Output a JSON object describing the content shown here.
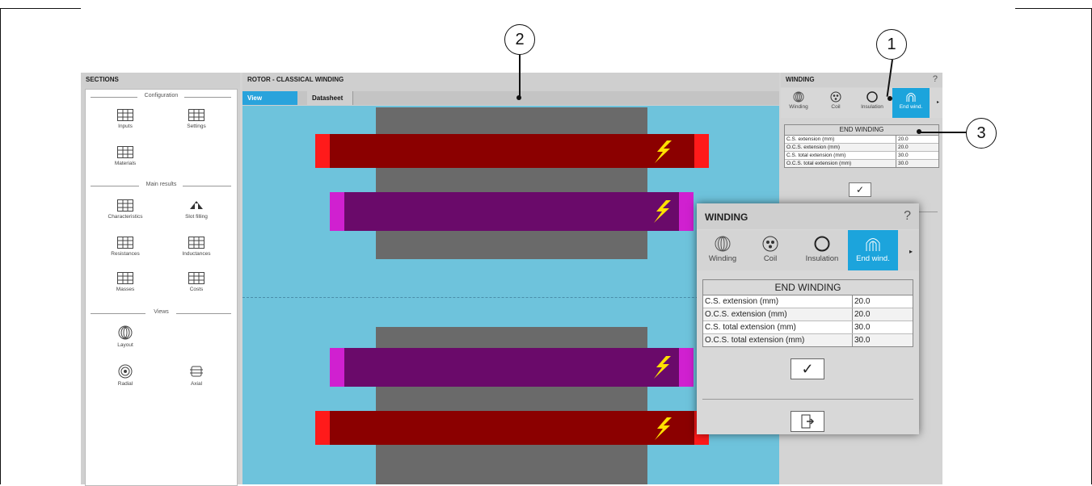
{
  "sections": {
    "header": "SECTIONS",
    "groups": [
      {
        "title": "Configuration",
        "items": [
          "Inputs",
          "Settings",
          "Materials"
        ]
      },
      {
        "title": "Main results",
        "items": [
          "Characteristics",
          "Slot filling",
          "Resistances",
          "Inductances",
          "Masses",
          "Costs"
        ]
      },
      {
        "title": "Views",
        "items": [
          "Layout",
          "Radial",
          "Axial"
        ]
      }
    ]
  },
  "center": {
    "header": "ROTOR - CLASSICAL WINDING",
    "tabs": [
      "View",
      "Datasheet"
    ]
  },
  "winding": {
    "header": "WINDING",
    "help": "?",
    "tabs": [
      "Winding",
      "Coil",
      "Insulation",
      "End wind."
    ],
    "more": "▸",
    "table": {
      "title": "END WINDING",
      "rows": [
        {
          "label": "C.S. extension (mm)",
          "value": "20.0"
        },
        {
          "label": "O.C.S. extension (mm)",
          "value": "20.0"
        },
        {
          "label": "C.S. total extension (mm)",
          "value": "30.0"
        },
        {
          "label": "O.C.S. total extension (mm)",
          "value": "30.0"
        }
      ]
    },
    "ok": "✓"
  },
  "popup": {
    "header": "WINDING",
    "help": "?",
    "tabs": [
      "Winding",
      "Coil",
      "Insulation",
      "End wind."
    ],
    "more": "▸",
    "table": {
      "title": "END WINDING",
      "rows": [
        {
          "label": "C.S. extension (mm)",
          "value": "20.0"
        },
        {
          "label": "O.C.S. extension (mm)",
          "value": "20.0"
        },
        {
          "label": "C.S. total extension (mm)",
          "value": "30.0"
        },
        {
          "label": "O.C.S. total extension (mm)",
          "value": "30.0"
        }
      ]
    },
    "ok": "✓"
  },
  "callouts": [
    "1",
    "2",
    "3"
  ],
  "colors": {
    "accent": "#1ca4dc",
    "view_bg": "#6ec3dc",
    "core": "#6a6a6a",
    "bar_red": "#8b0000",
    "bar_red_end": "#ff1a1a",
    "bar_purple": "#6a0a6a",
    "bar_purple_end": "#d020d0",
    "lightning": "#ffe000"
  }
}
